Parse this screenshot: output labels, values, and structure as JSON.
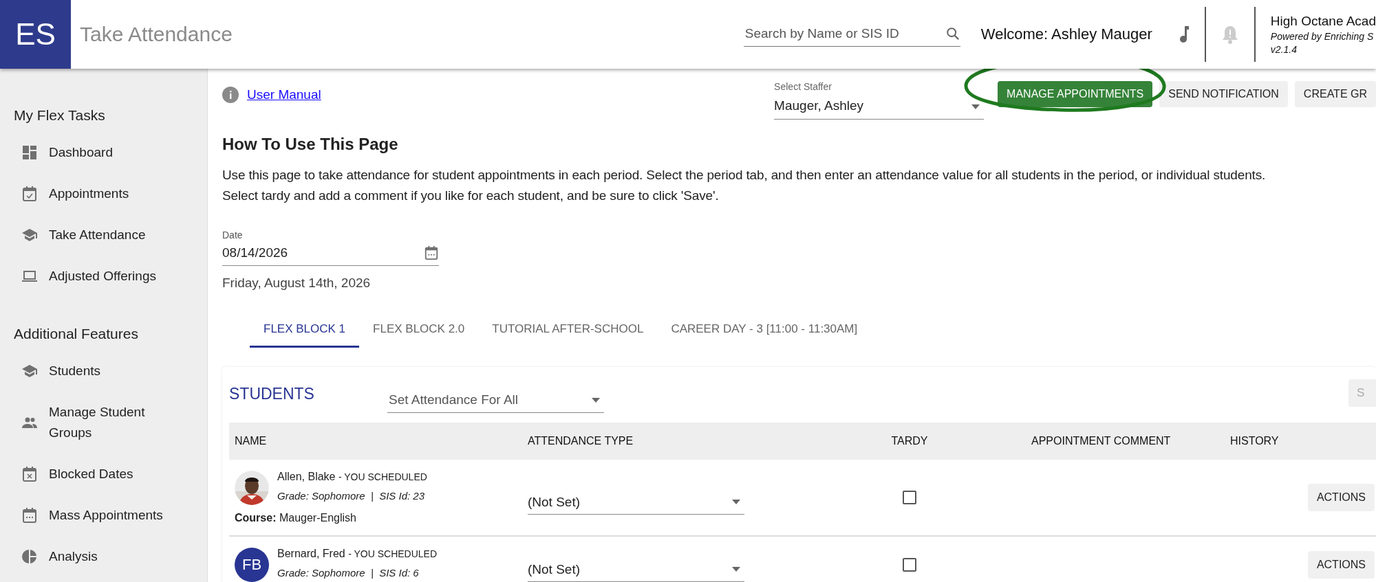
{
  "header": {
    "logo": "ES",
    "title": "Take Attendance",
    "search": {
      "placeholder": "Search by Name or SIS ID"
    },
    "welcome": "Welcome: Ashley Mauger",
    "org": {
      "name": "High Octane Acad",
      "powered": "Powered by Enriching S",
      "version": "v2.1.4"
    }
  },
  "sidebar": {
    "sections": [
      {
        "title": "My Flex Tasks",
        "items": [
          {
            "label": "Dashboard"
          },
          {
            "label": "Appointments"
          },
          {
            "label": "Take Attendance"
          },
          {
            "label": "Adjusted Offerings"
          }
        ]
      },
      {
        "title": "Additional Features",
        "items": [
          {
            "label": "Students"
          },
          {
            "label": "Manage Student Groups"
          },
          {
            "label": "Blocked Dates"
          },
          {
            "label": "Mass Appointments"
          },
          {
            "label": "Analysis"
          }
        ]
      }
    ]
  },
  "user_manual": "User Manual",
  "staffer": {
    "label": "Select Staffer",
    "value": "Mauger, Ashley"
  },
  "buttons": [
    {
      "label": "MANAGE APPOINTMENTS",
      "kind": "primary",
      "circled": true
    },
    {
      "label": "SEND NOTIFICATION",
      "kind": "plain",
      "circled": false
    },
    {
      "label": "CREATE GR",
      "kind": "plain",
      "circled": false
    }
  ],
  "help": {
    "heading": "How To Use This Page",
    "lines": [
      "Use this page to take attendance for student appointments in each period. Select the period tab, and then enter an attendance value for all students in the period, or individual students.",
      "Select tardy and add a comment if you like for each student, and be sure to click 'Save'."
    ]
  },
  "date": {
    "label": "Date",
    "value": "08/14/2026",
    "long": "Friday, August 14th, 2026"
  },
  "tabs": [
    {
      "label": "FLEX BLOCK 1",
      "selected": true
    },
    {
      "label": "FLEX BLOCK 2.0",
      "selected": false
    },
    {
      "label": "TUTORIAL AFTER-SCHOOL",
      "selected": false
    },
    {
      "label": "CAREER DAY - 3 [11:00 - 11:30AM]",
      "selected": false
    }
  ],
  "students": {
    "title": "STUDENTS",
    "set_all": {
      "placeholder": "Set Attendance For All"
    },
    "save_button": "S",
    "columns": [
      "NAME",
      "ATTENDANCE TYPE",
      "TARDY",
      "APPOINTMENT COMMENT",
      "HISTORY"
    ],
    "rows": [
      {
        "name": "Allen, Blake",
        "tag": "- YOU SCHEDULED",
        "info": "Grade: Sophomore  |  SIS Id: 23",
        "course": "**Course:** Mauger-English",
        "attendance": "(Not Set)",
        "tardy": false,
        "action": "ACTIONS"
      },
      {
        "avatar": {
          "kind": "initials",
          "text": "FB"
        },
        "name": "Bernard, Fred",
        "tag": "- YOU SCHEDULED",
        "info": "Grade: Sophomore  |  SIS Id: 6",
        "attendance": "(Not Set)",
        "tardy": false,
        "action": "ACTIONS"
      }
    ]
  }
}
